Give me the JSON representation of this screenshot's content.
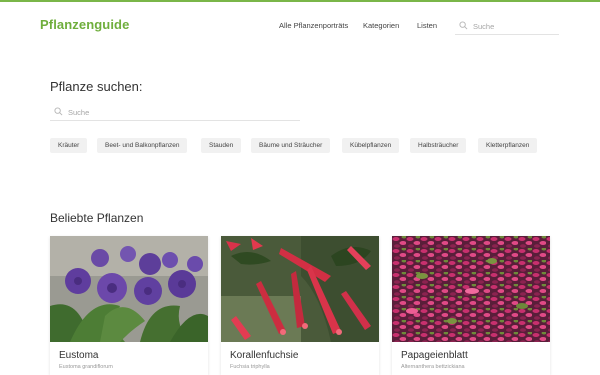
{
  "brand": {
    "logo": "Pflanzenguide",
    "accent": "#7ab648"
  },
  "nav": {
    "items": [
      "Alle Pflanzenporträts",
      "Kategorien",
      "Listen"
    ],
    "search_placeholder": "Suche"
  },
  "finder": {
    "heading": "Pflanze suchen:",
    "search_placeholder": "Suche",
    "categories": [
      "Kräuter",
      "Beet- und Balkonpflanzen",
      "Stauden",
      "Bäume und Sträucher",
      "Kübelpflanzen",
      "Halbsträucher",
      "Kletterpflanzen"
    ]
  },
  "popular": {
    "heading": "Beliebte Pflanzen",
    "cards": [
      {
        "name": "Eustoma",
        "latin": "Eustoma grandiflorum",
        "image": "purple eustoma flowers"
      },
      {
        "name": "Korallenfuchsie",
        "latin": "Fuchsia triphylla",
        "image": "red coral fuchsia flowers"
      },
      {
        "name": "Papageienblatt",
        "latin": "Alternanthera bettzickiana",
        "image": "magenta leafy groundcover"
      }
    ]
  }
}
